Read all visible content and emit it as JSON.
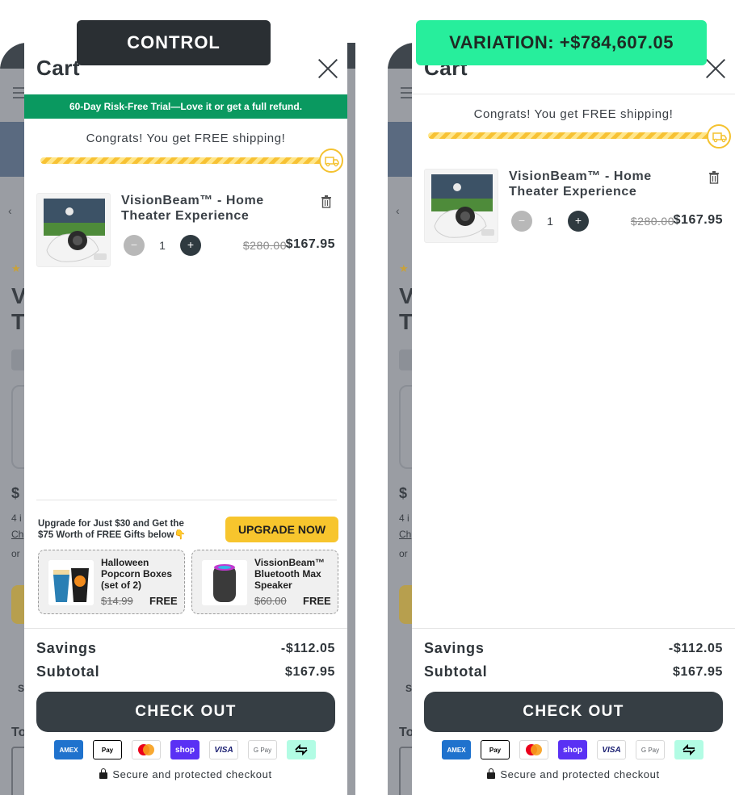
{
  "labels": {
    "control": "CONTROL",
    "variation": "VARIATION: +$784,607.05"
  },
  "background_page": {
    "title_letters": [
      "V",
      "T"
    ],
    "price_fragment": "$",
    "small_lines": [
      "4 i",
      "Ch",
      "or"
    ],
    "s_fragment": "S",
    "to_fragment": "To"
  },
  "cart": {
    "title": "Cart",
    "trial_banner": "60-Day Risk-Free Trial—Love it or get a full refund.",
    "shipping_message": "Congrats! You get FREE shipping!",
    "shipping_progress_percent": 100,
    "item": {
      "name": "VisionBeam™ - Home Theater Experience",
      "quantity": "1",
      "qty_minus": "−",
      "qty_plus": "+",
      "original_price": "$280.00",
      "sale_price": "$167.95"
    },
    "upsell": {
      "text": "Upgrade for Just $30 and Get the $75 Worth of FREE Gifts below👇",
      "button": "UPGRADE NOW",
      "gifts": [
        {
          "name": "Halloween Popcorn Boxes (set of 2)",
          "original_price": "$14.99",
          "price": "FREE"
        },
        {
          "name": "VissionBeam™ Bluetooth Max Speaker",
          "original_price": "$60.00",
          "price": "FREE"
        }
      ]
    },
    "savings_label": "Savings",
    "savings_value": "-$112.05",
    "subtotal_label": "Subtotal",
    "subtotal_value": "$167.95",
    "checkout_button": "CHECK OUT",
    "payment_methods": [
      "amex",
      "apple-pay",
      "mastercard",
      "shop-pay",
      "visa",
      "google-pay",
      "afterpay"
    ],
    "payment_labels": {
      "amex": "AMEX",
      "apple_pay": "Pay",
      "shop_pay": "shop",
      "visa": "VISA",
      "google_pay": "G Pay"
    },
    "secure_text": "Secure and protected checkout"
  },
  "colors": {
    "trial_banner": "#0a9960",
    "progress": "#f7c234",
    "upgrade_button": "#f7c52d",
    "checkout_button": "#363e44",
    "variation_label": "#27ee9c",
    "control_label": "#2a2f33"
  }
}
